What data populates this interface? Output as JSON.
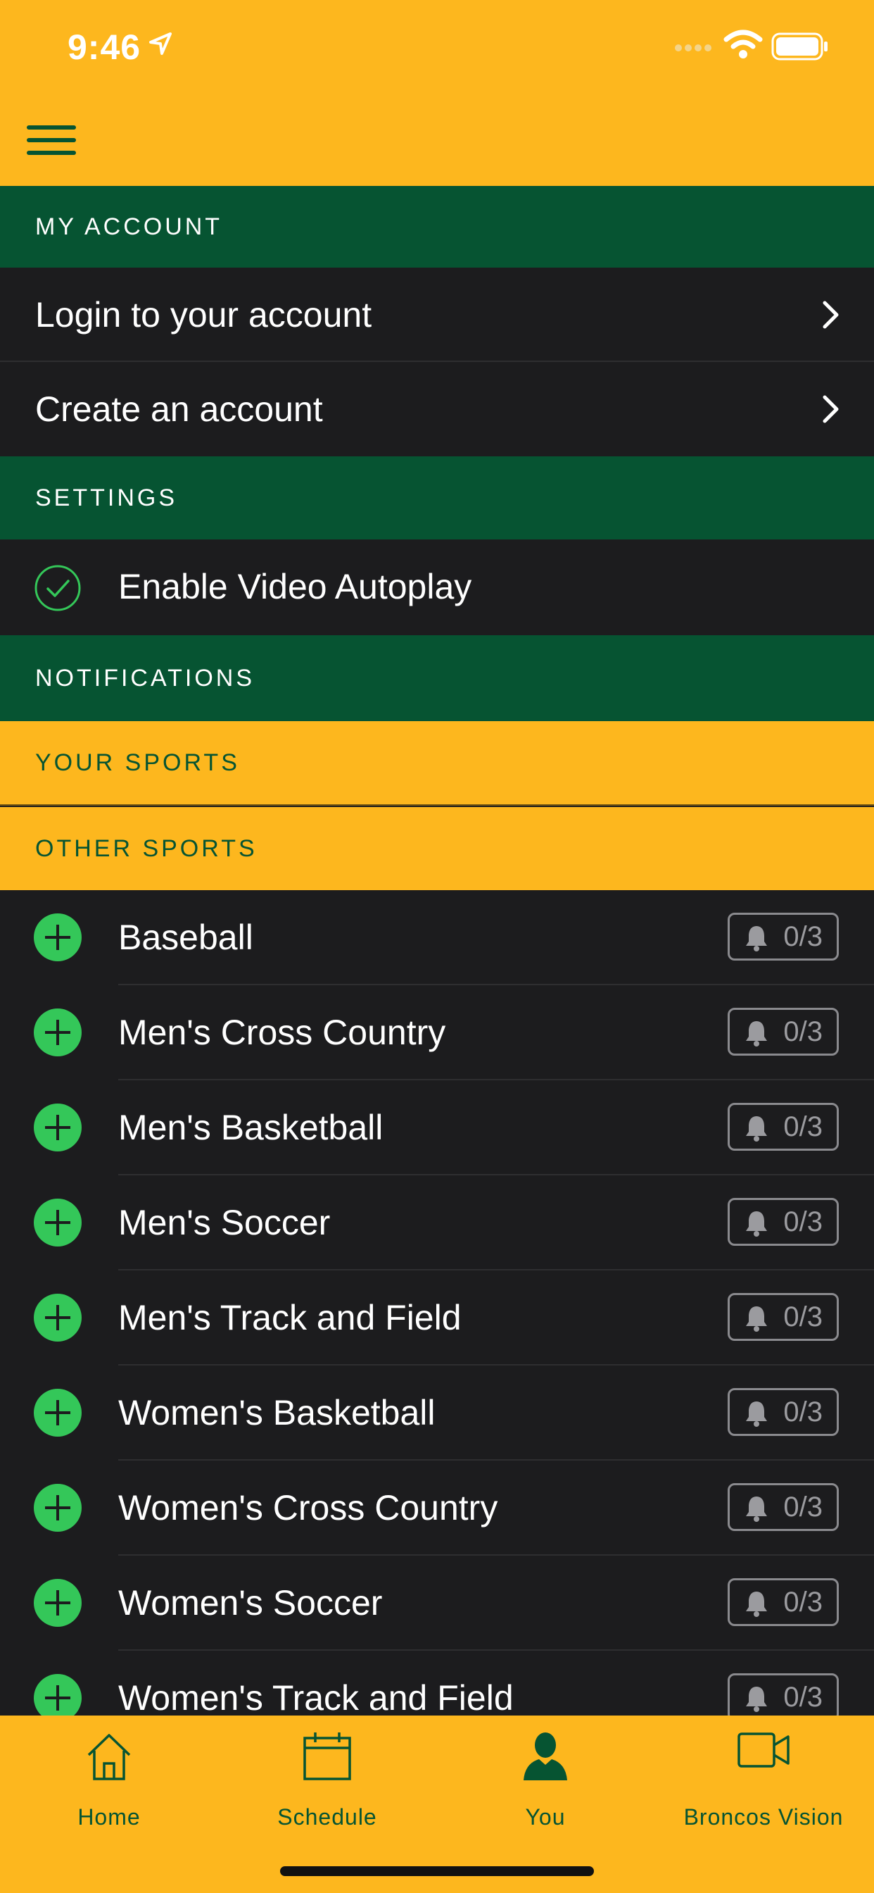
{
  "status": {
    "time": "9:46"
  },
  "sections": {
    "my_account": "MY ACCOUNT",
    "settings": "SETTINGS",
    "notifications": "NOTIFICATIONS",
    "your_sports": "YOUR SPORTS",
    "other_sports": "OTHER SPORTS"
  },
  "account": {
    "login": "Login to your account",
    "create": "Create an account"
  },
  "settings": {
    "autoplay": "Enable Video Autoplay",
    "autoplay_enabled": true
  },
  "sports": [
    {
      "name": "Baseball",
      "count": "0/3"
    },
    {
      "name": "Men's Cross Country",
      "count": "0/3"
    },
    {
      "name": "Men's Basketball",
      "count": "0/3"
    },
    {
      "name": "Men's Soccer",
      "count": "0/3"
    },
    {
      "name": "Men's Track and Field",
      "count": "0/3"
    },
    {
      "name": "Women's Basketball",
      "count": "0/3"
    },
    {
      "name": "Women's Cross Country",
      "count": "0/3"
    },
    {
      "name": "Women's Soccer",
      "count": "0/3"
    },
    {
      "name": "Women's Track and Field",
      "count": "0/3"
    }
  ],
  "tabs": {
    "home": "Home",
    "schedule": "Schedule",
    "you": "You",
    "vision": "Broncos Vision",
    "active": "You"
  },
  "colors": {
    "gold": "#fdb71e",
    "green": "#065432",
    "row_bg": "#1c1c1e",
    "add_green": "#34c759"
  }
}
